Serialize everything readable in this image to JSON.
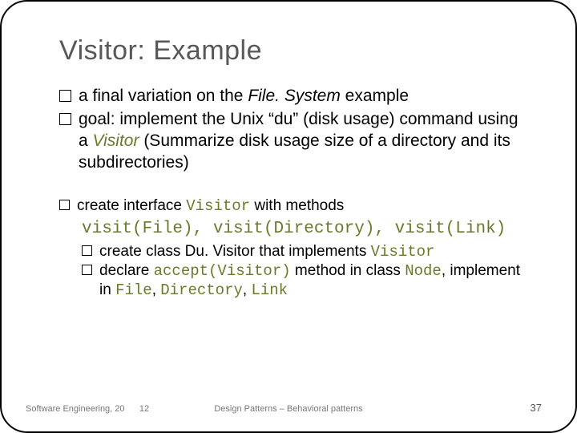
{
  "title": "Visitor: Example",
  "b1_a": "a final variation on the ",
  "b1_i": "File. System",
  "b1_b": " example",
  "b2_a": "goal: implement the Unix “du” (disk usage) command using a ",
  "b2_i": "Visitor",
  "b2_b": " (Summarize disk usage size of a directory and its subdirectories)",
  "b3_a": "create interface ",
  "b3_m": "Visitor",
  "b3_b": " with methods ",
  "b3_mono_line": "visit(File), visit(Directory), visit(Link)",
  "b4_a": "create class Du. Visitor that implements ",
  "b4_m": "Visitor",
  "b5_a": "declare ",
  "b5_m1": "accept(Visitor)",
  "b5_b": " method in class ",
  "b5_m2": "Node",
  "b5_c": ", implement in ",
  "b5_m3": "File",
  "b5_d": ", ",
  "b5_m4": "Directory",
  "b5_e": ", ",
  "b5_m5": "Link",
  "footer_left": "Software Engineering, 20",
  "footer_left2": "12",
  "footer_mid": "Design Patterns – Behavioral patterns",
  "footer_right": "37",
  "chart_data": null
}
